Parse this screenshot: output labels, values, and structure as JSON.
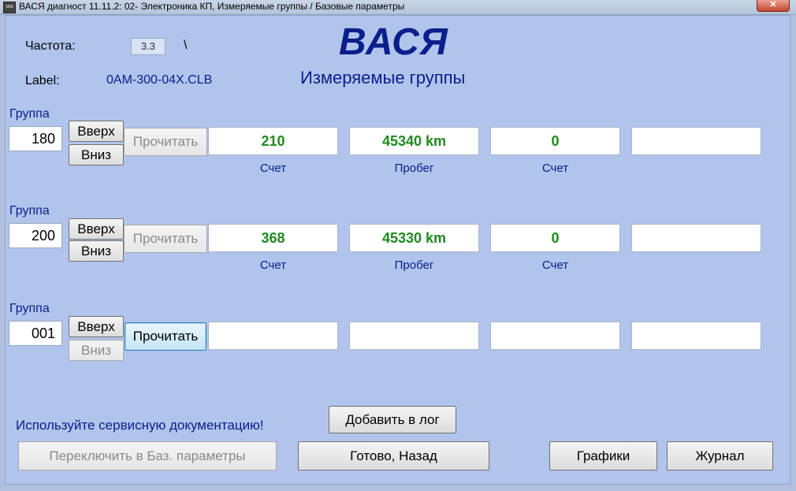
{
  "window": {
    "title": "ВАСЯ диагност 11.11.2: 02- Электроника КП,  Измеряемые группы / Базовые параметры",
    "icon": "vasya-app-icon",
    "close": "✕"
  },
  "header": {
    "freq_label": "Частота:",
    "freq_value": "3.3",
    "freq_indicator": "\\",
    "label_label": "Label:",
    "label_value": "0AM-300-04X.CLB",
    "logo": "ВАСЯ",
    "subtitle": "Измеряемые группы"
  },
  "groups": [
    {
      "label": "Группа",
      "number": "180",
      "up": "Вверх",
      "down": "Вниз",
      "read": "Прочитать",
      "values": [
        "210",
        "45340 km",
        "0",
        ""
      ],
      "captions": [
        "Счет",
        "Пробег",
        "Счет",
        ""
      ]
    },
    {
      "label": "Группа",
      "number": "200",
      "up": "Вверх",
      "down": "Вниз",
      "read": "Прочитать",
      "values": [
        "368",
        "45330 km",
        "0",
        ""
      ],
      "captions": [
        "Счет",
        "Пробег",
        "Счет",
        ""
      ]
    },
    {
      "label": "Группа",
      "number": "001",
      "up": "Вверх",
      "down": "Вниз",
      "read": "Прочитать",
      "values": [
        "",
        "",
        "",
        ""
      ],
      "captions": [
        "",
        "",
        "",
        ""
      ]
    }
  ],
  "footer": {
    "hint": "Используйте сервисную документацию!",
    "add_log": "Добавить в лог",
    "switch_basic": "Переключить в Баз. параметры",
    "done_back": "Готово, Назад",
    "graphs": "Графики",
    "journal": "Журнал"
  },
  "colors": {
    "background": "#b1c4ec",
    "value_text": "#1f8a1f",
    "label_text": "#0a1e8c"
  }
}
